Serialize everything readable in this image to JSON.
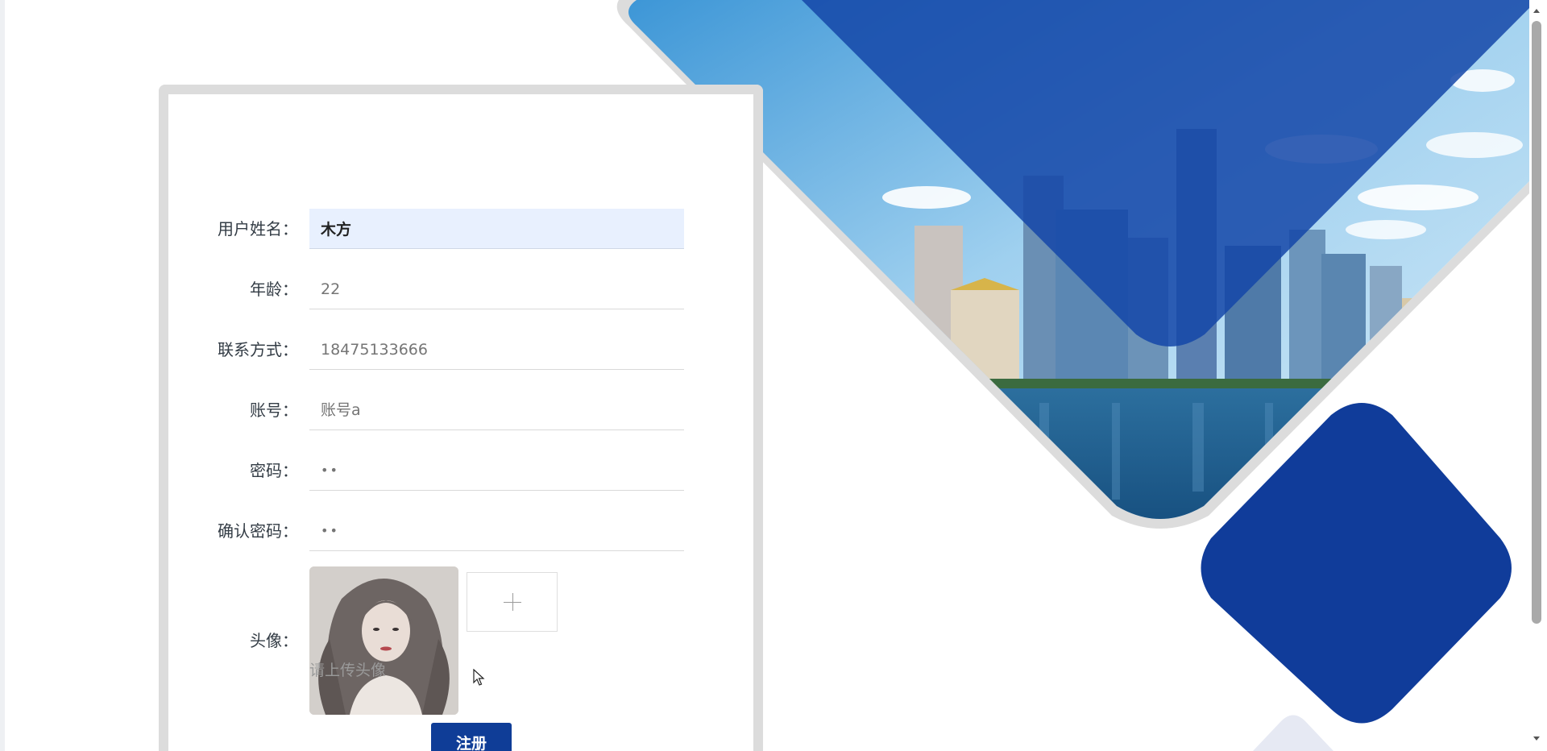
{
  "form": {
    "fields": [
      {
        "label": "用户姓名：",
        "value": "木方",
        "placeholder": ""
      },
      {
        "label": "年龄：",
        "value": "",
        "placeholder": "22"
      },
      {
        "label": "联系方式：",
        "value": "",
        "placeholder": "18475133666"
      },
      {
        "label": "账号：",
        "value": "",
        "placeholder": "账号a"
      },
      {
        "label": "密码：",
        "value": "",
        "placeholder": "••"
      },
      {
        "label": "确认密码：",
        "value": "",
        "placeholder": "••"
      }
    ],
    "avatar_label": "头像：",
    "avatar_hint": "请上传头像",
    "submit_label": "注册"
  },
  "colors": {
    "primary": "#0f3d97",
    "sky": "#6fb3e4",
    "diamond": "#103c9a"
  },
  "icons": {
    "upload": "plus-icon",
    "cursor": "mouse-pointer-icon"
  }
}
